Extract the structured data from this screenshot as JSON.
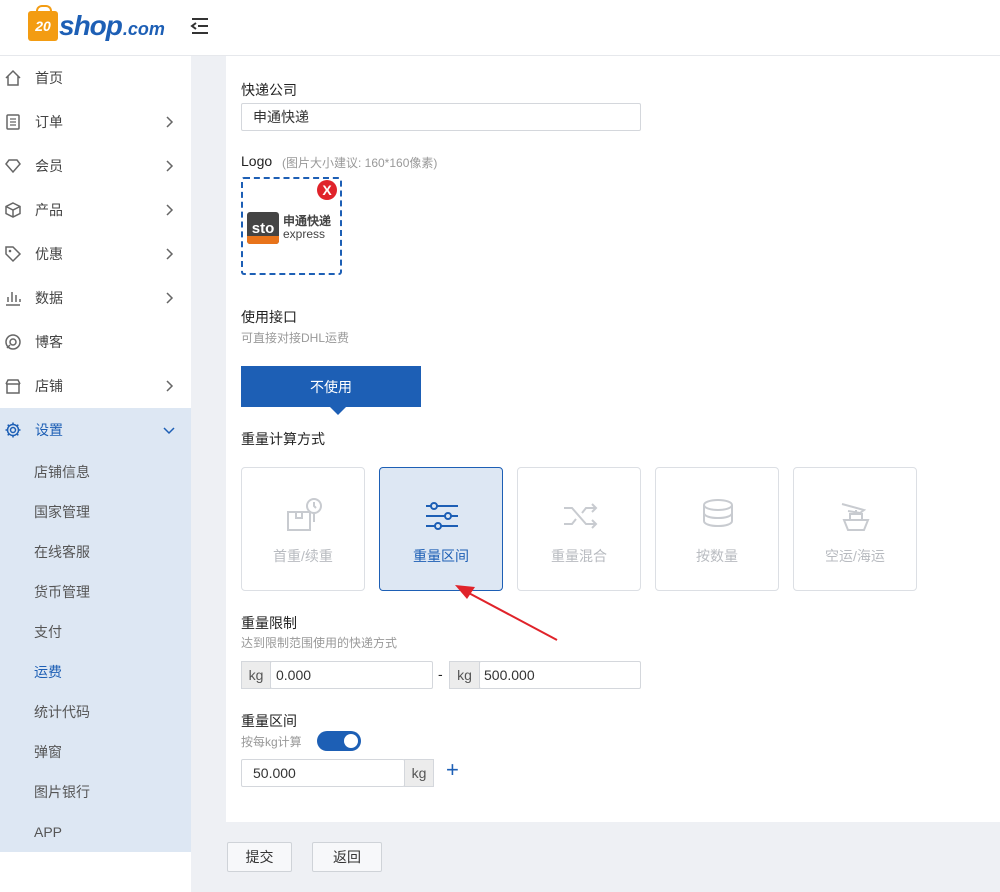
{
  "brand": {
    "bag_text": "20",
    "name": "shop",
    "suffix": ".com"
  },
  "sidebar": {
    "items": [
      {
        "label": "首页",
        "icon": "home-icon"
      },
      {
        "label": "订单",
        "icon": "order-icon"
      },
      {
        "label": "会员",
        "icon": "member-icon"
      },
      {
        "label": "产品",
        "icon": "product-icon"
      },
      {
        "label": "优惠",
        "icon": "tag-icon"
      },
      {
        "label": "数据",
        "icon": "chart-icon"
      },
      {
        "label": "博客",
        "icon": "blog-icon"
      },
      {
        "label": "店铺",
        "icon": "shop-icon"
      },
      {
        "label": "设置",
        "icon": "gear-icon"
      }
    ],
    "submenu": [
      {
        "label": "店铺信息"
      },
      {
        "label": "国家管理"
      },
      {
        "label": "在线客服"
      },
      {
        "label": "货币管理"
      },
      {
        "label": "支付"
      },
      {
        "label": "运费"
      },
      {
        "label": "统计代码"
      },
      {
        "label": "弹窗"
      },
      {
        "label": "图片银行"
      },
      {
        "label": "APP"
      }
    ]
  },
  "form": {
    "courier_label": "快递公司",
    "courier_value": "申通快递",
    "logo_label": "Logo",
    "logo_hint": "(图片大小建议: 160*160像素)",
    "logo_remove": "X",
    "sto_badge": "sto",
    "sto_cn": "申通快递",
    "sto_en": "express",
    "api_label": "使用接口",
    "api_hint": "可直接对接DHL运费",
    "api_button": "不使用",
    "method_label": "重量计算方式",
    "methods": [
      {
        "label": "首重/续重",
        "icon": "scale-box-icon"
      },
      {
        "label": "重量区间",
        "icon": "sliders-icon"
      },
      {
        "label": "重量混合",
        "icon": "shuffle-icon"
      },
      {
        "label": "按数量",
        "icon": "stack-icon"
      },
      {
        "label": "空运/海运",
        "icon": "plane-ship-icon"
      }
    ],
    "limit_label": "重量限制",
    "limit_hint": "达到限制范围使用的快递方式",
    "unit": "kg",
    "limit_min": "0.000",
    "limit_max": "500.000",
    "range_dash": "-",
    "range_label": "重量区间",
    "per_kg_label": "按每kg计算",
    "per_kg_enabled": true,
    "range_value": "50.000",
    "add_symbol": "+"
  },
  "actions": {
    "submit": "提交",
    "back": "返回"
  },
  "colors": {
    "primary": "#1d5fb5",
    "active_bg": "#dde7f3",
    "brand_orange": "#f39c12",
    "danger": "#e0232a"
  }
}
